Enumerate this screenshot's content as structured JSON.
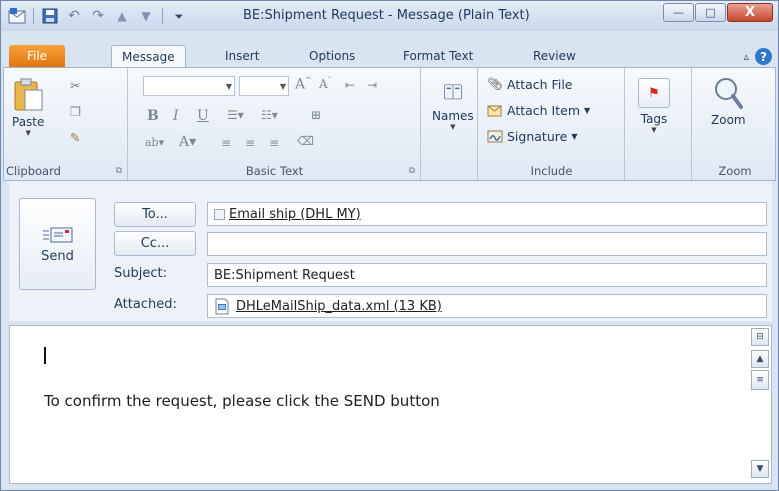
{
  "window": {
    "title": "BE:Shipment Request  -  Message (Plain Text)",
    "minimize": "—",
    "maximize": "□",
    "close": "X"
  },
  "tabs": [
    "File",
    "Message",
    "Insert",
    "Options",
    "Format Text",
    "Review"
  ],
  "ribbon": {
    "clipboard": {
      "label": "Clipboard",
      "paste": "Paste"
    },
    "basic_text": {
      "label": "Basic Text"
    },
    "names": {
      "label": "Names"
    },
    "include": {
      "label": "Include",
      "attach_file": "Attach File",
      "attach_item": "Attach Item",
      "signature": "Signature"
    },
    "tags": {
      "label": "Tags"
    },
    "zoom": {
      "label": "Zoom",
      "button": "Zoom"
    }
  },
  "header": {
    "send": "Send",
    "to_button": "To...",
    "cc_button": "Cc...",
    "subject_label": "Subject:",
    "attached_label": "Attached:",
    "to_value": "Email ship (DHL MY)",
    "cc_value": "",
    "subject_value": "BE:Shipment Request",
    "attachment": "DHLeMailShip_data.xml (13 KB)"
  },
  "body": {
    "text": "To confirm the request, please click the SEND button"
  }
}
